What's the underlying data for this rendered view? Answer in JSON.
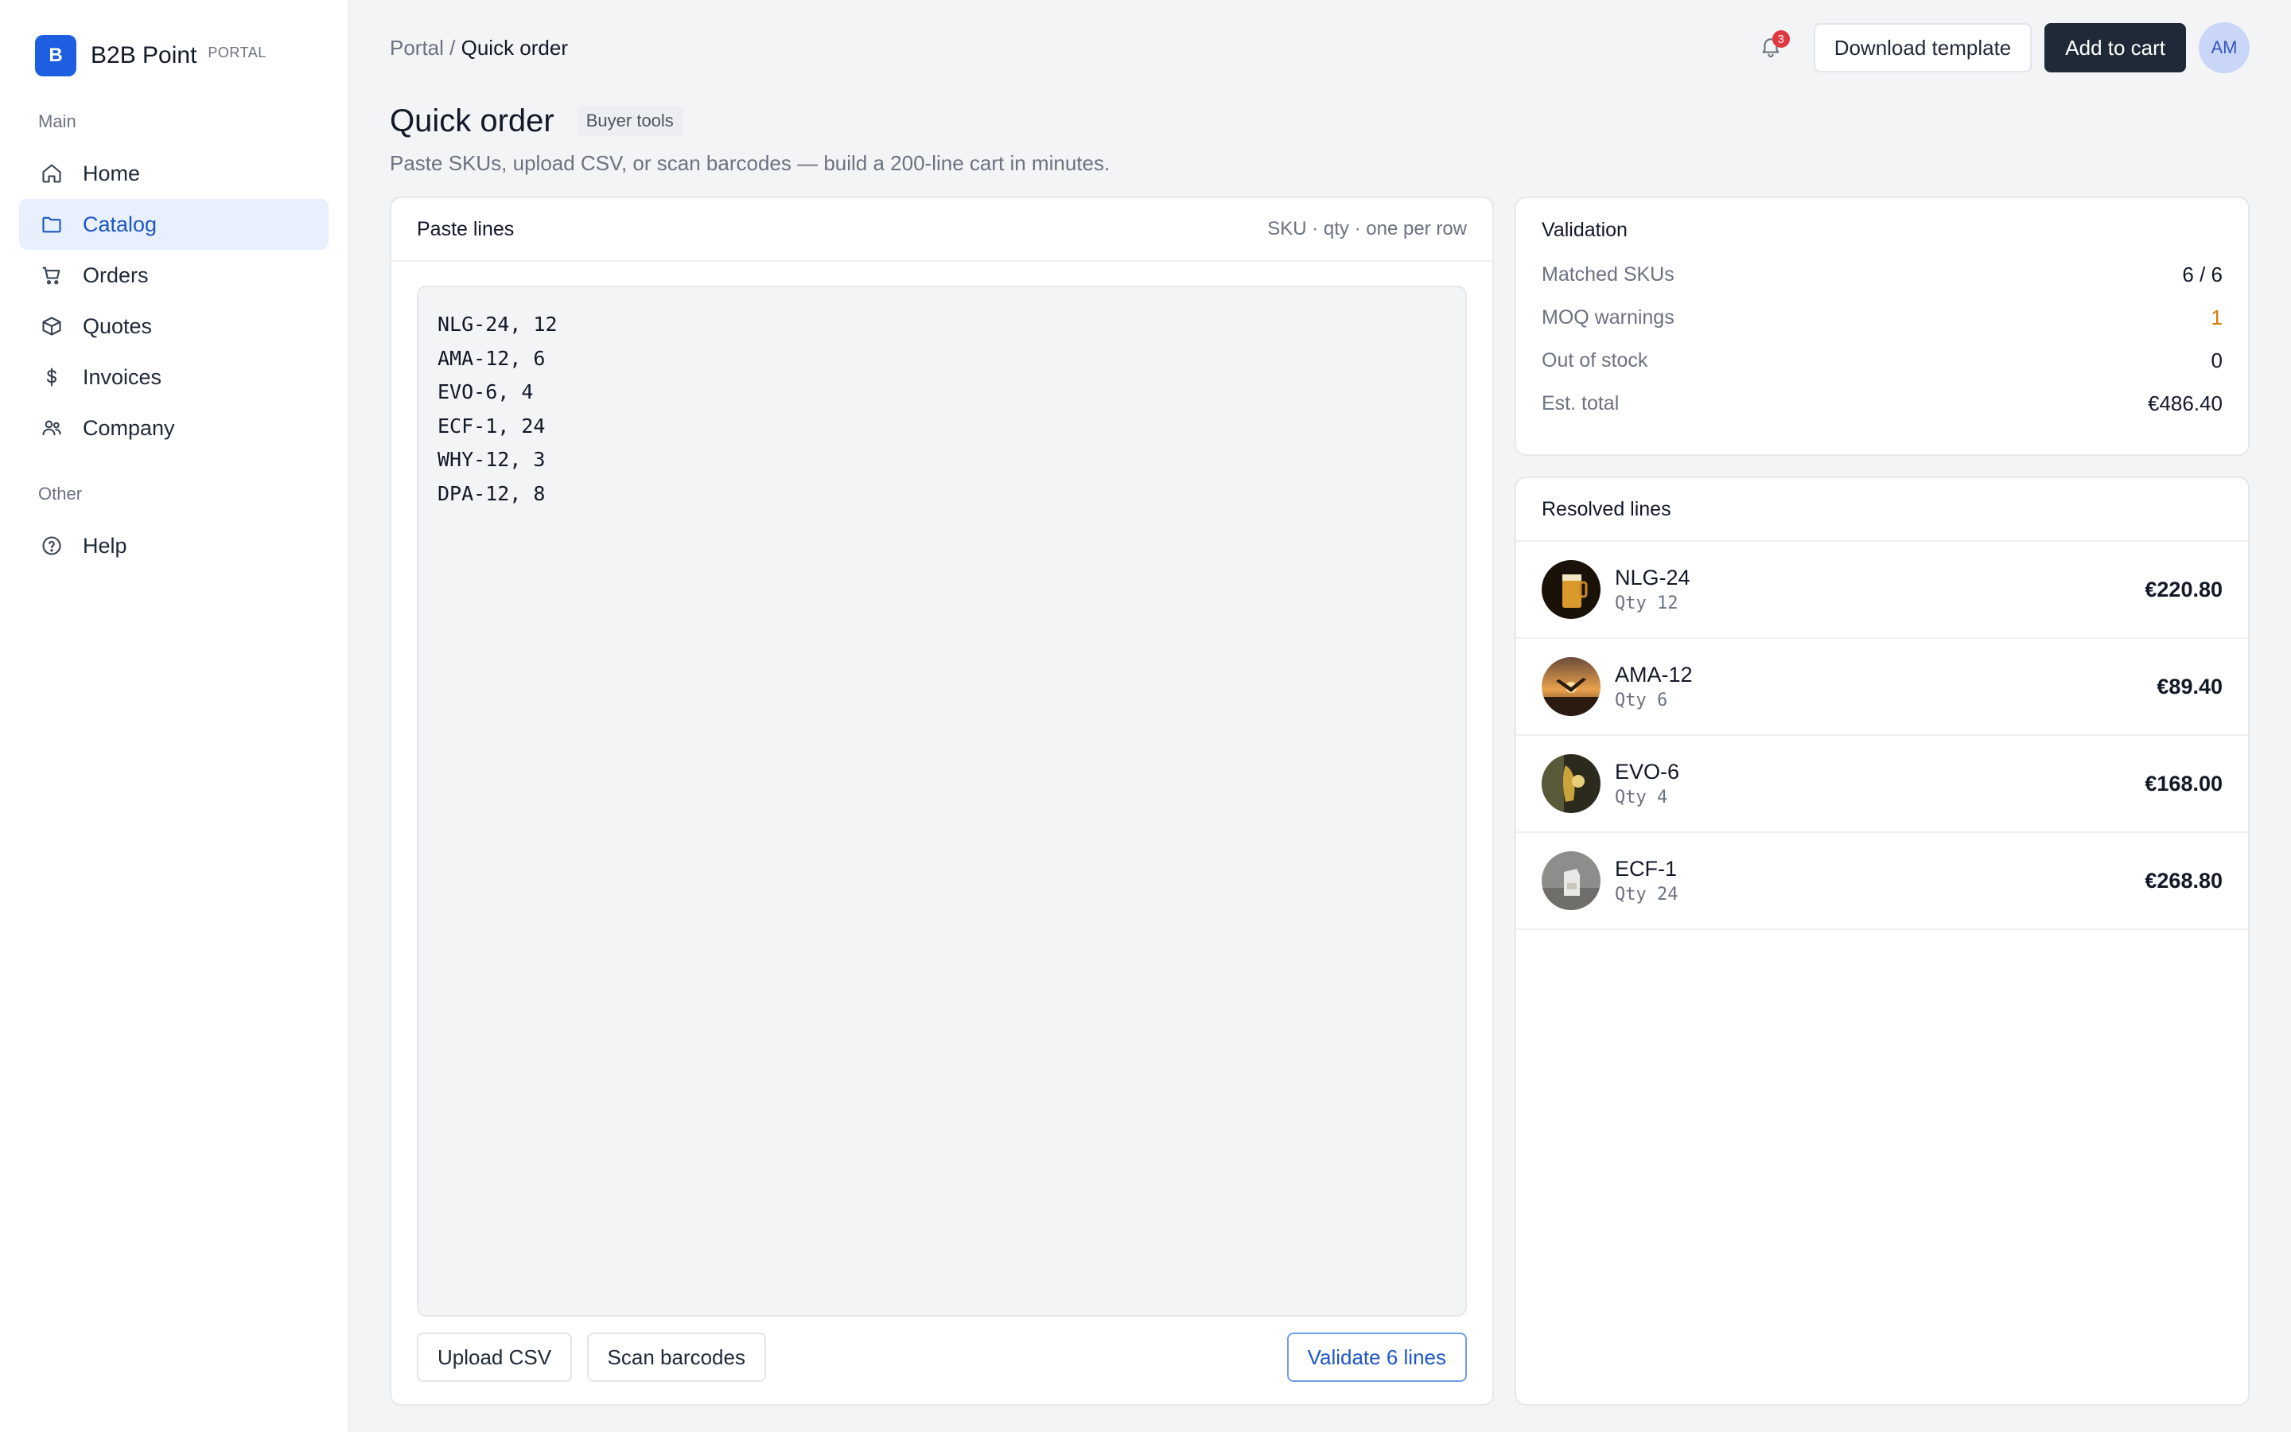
{
  "brand": {
    "logo_letter": "B",
    "name": "B2B Point",
    "tag": "PORTAL"
  },
  "sidebar": {
    "section_main": "Main",
    "items": [
      {
        "label": "Home",
        "icon": "home-icon"
      },
      {
        "label": "Catalog",
        "icon": "folder-icon",
        "active": true
      },
      {
        "label": "Orders",
        "icon": "cart-icon"
      },
      {
        "label": "Quotes",
        "icon": "box-icon"
      },
      {
        "label": "Invoices",
        "icon": "dollar-icon"
      },
      {
        "label": "Company",
        "icon": "users-icon"
      }
    ],
    "section_other": "Other",
    "other_items": [
      {
        "label": "Help",
        "icon": "help-circle-icon"
      }
    ]
  },
  "header": {
    "breadcrumb_root": "Portal",
    "breadcrumb_sep": "/",
    "breadcrumb_current": "Quick order",
    "notifications_count": "3",
    "download_label": "Download template",
    "add_to_cart_label": "Add to cart",
    "avatar_initials": "AM"
  },
  "page": {
    "title": "Quick order",
    "chip": "Buyer tools",
    "subtitle": "Paste SKUs, upload CSV, or scan barcodes — build a 200-line cart in minutes."
  },
  "paste": {
    "title": "Paste lines",
    "hint": "SKU · qty · one per row",
    "lines": [
      "NLG-24, 12",
      "AMA-12, 6",
      "EVO-6, 4",
      "ECF-1, 24",
      "WHY-12, 3",
      "DPA-12, 8"
    ],
    "upload_label": "Upload CSV",
    "scan_label": "Scan barcodes",
    "validate_label": "Validate 6 lines"
  },
  "validation": {
    "title": "Validation",
    "rows": [
      {
        "label": "Matched SKUs",
        "value": "6 / 6"
      },
      {
        "label": "MOQ warnings",
        "value": "1"
      },
      {
        "label": "Out of stock",
        "value": "0"
      },
      {
        "label": "Est. total",
        "value": "€486.40"
      }
    ]
  },
  "resolved": {
    "title": "Resolved lines",
    "items": [
      {
        "sku": "NLG-24",
        "qty": "Qty 12",
        "price": "€220.80"
      },
      {
        "sku": "AMA-12",
        "qty": "Qty 6",
        "price": "€89.40"
      },
      {
        "sku": "EVO-6",
        "qty": "Qty 4",
        "price": "€168.00"
      },
      {
        "sku": "ECF-1",
        "qty": "Qty 24",
        "price": "€268.80"
      }
    ]
  },
  "colors": {
    "accent": "#1d5fe0",
    "active_bg": "#e8f0fd",
    "warning": "#d97706",
    "badge": "#e0383e",
    "dark_button": "#1f2937"
  }
}
